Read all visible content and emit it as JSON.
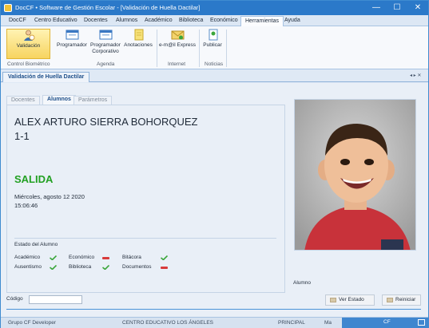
{
  "window": {
    "title": "DocCF • Software de Gestión Escolar  - [Validación de Huella Dactilar]",
    "minimize": "—",
    "maximize": "☐",
    "close": "✕"
  },
  "menu": {
    "tabs": [
      "DocCF",
      "Centro Educativo",
      "Docentes",
      "Alumnos",
      "Académico",
      "Biblioteca",
      "Económico",
      "Herramientas",
      "Ayuda"
    ],
    "active": "Herramientas"
  },
  "ribbon": {
    "buttons": {
      "validacion": "Validación",
      "programador": "Programador",
      "programador_corporativo_1": "Programador",
      "programador_corporativo_2": "Corporativo",
      "anotaciones": "Anotaciones",
      "email_express": "e-m@il Express",
      "publicar": "Publicar"
    },
    "groups": {
      "control_biometrico": "Control Biométrico",
      "agenda": "Agenda",
      "internet": "Internet",
      "noticias": "Noticias"
    }
  },
  "document_tab": {
    "label": "Validación de Huella Dactilar",
    "controls": "◂ ▸ ✕"
  },
  "subtabs": [
    "Docentes",
    "Alumnos",
    "Parámetros"
  ],
  "student": {
    "name": "ALEX ARTURO  SIERRA BOHORQUEZ",
    "grade": "1-1",
    "status": "SALIDA",
    "date": "Miércoles, agosto 12 2020",
    "time": "15:06:46"
  },
  "estado_alumno": {
    "title": "Estado del Alumno",
    "items": [
      {
        "label": "Académico",
        "ok": true
      },
      {
        "label": "Económico",
        "ok": false
      },
      {
        "label": "Bitácora",
        "ok": true
      },
      {
        "label": "Ausentismo",
        "ok": true
      },
      {
        "label": "Biblioteca",
        "ok": true
      },
      {
        "label": "Documentos",
        "ok": false
      }
    ]
  },
  "photo_label": "Alumno",
  "codigo": {
    "label": "Código",
    "value": ""
  },
  "actions": {
    "ver_estado": "Ver Estado",
    "reiniciar": "Reiniciar"
  },
  "statusbar": {
    "developer": "Grupo CF Developer",
    "centro": "CENTRO EDUCATIVO LOS ÁNGELES",
    "sede": "PRINCIPAL",
    "jornada": "Ma",
    "cf": "CF"
  },
  "colors": {
    "title_bar": "#2b79c9",
    "status_salida": "#22a022",
    "ok_check": "#3aa63a",
    "fail_dash": "#d83b3b"
  }
}
